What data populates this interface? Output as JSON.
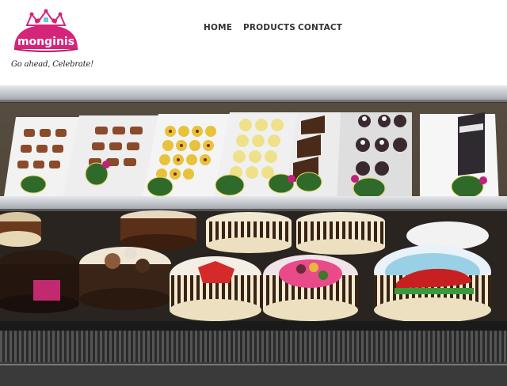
{
  "brand": {
    "name": "monginis",
    "tagline": "Go ahead, Celebrate!",
    "colors": {
      "magenta": "#d6247a",
      "gold": "#e2b01f"
    }
  },
  "nav": {
    "items": [
      {
        "label": "HOME"
      },
      {
        "label": "PRODUCTS"
      },
      {
        "label": "CONTACT"
      }
    ]
  },
  "hero": {
    "icon": "bakery-display-photo",
    "colors": {
      "frame": "#1c1c1c",
      "glass": "#d8dbe0",
      "cream": "#f4ead0",
      "chocolate": "#4a2a18"
    }
  }
}
